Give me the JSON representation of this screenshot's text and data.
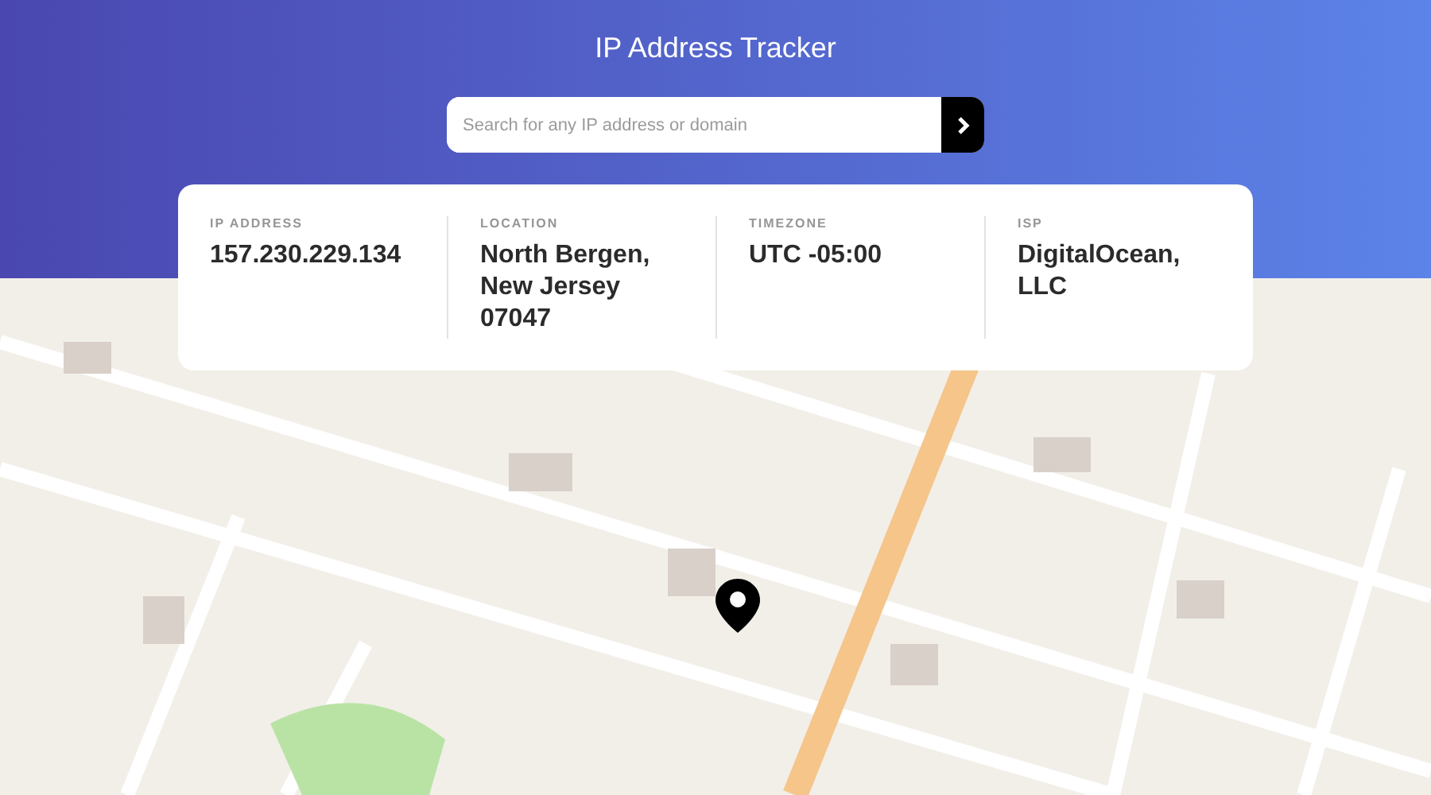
{
  "header": {
    "title": "IP Address Tracker"
  },
  "search": {
    "placeholder": "Search for any IP address or domain"
  },
  "info": [
    {
      "label": "IP ADDRESS",
      "value": "157.230.229.134"
    },
    {
      "label": "LOCATION",
      "value": "North Bergen, New Jersey 07047"
    },
    {
      "label": "TIMEZONE",
      "value": "UTC -05:00"
    },
    {
      "label": "ISP",
      "value": "DigitalOcean, LLC"
    }
  ]
}
